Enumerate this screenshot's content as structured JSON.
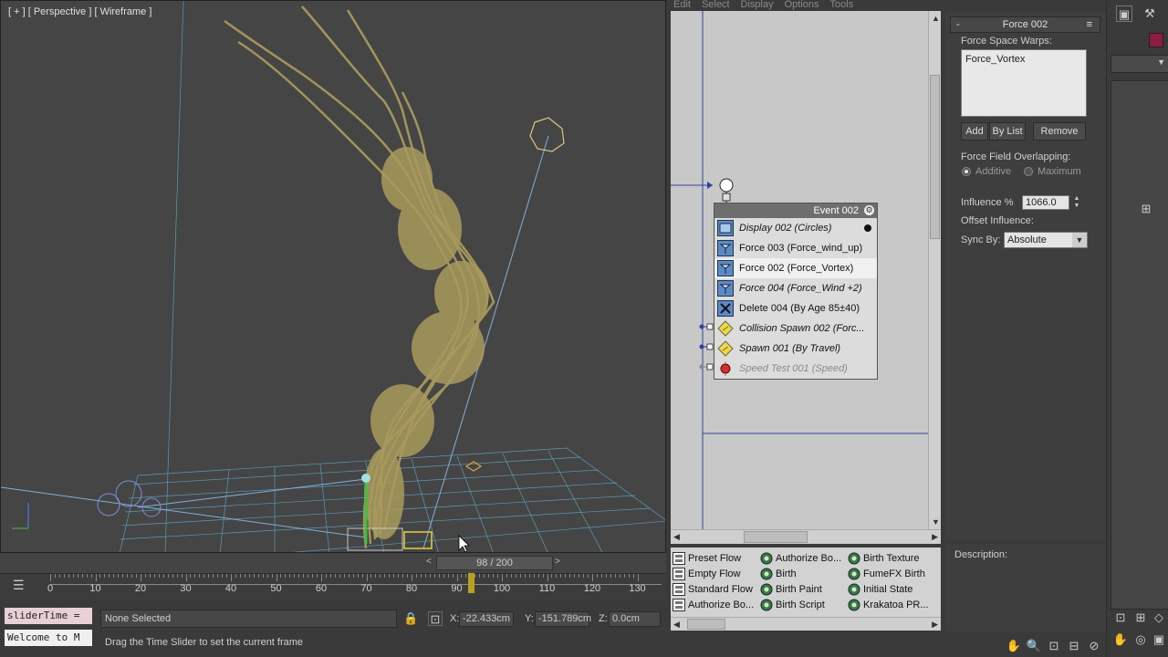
{
  "viewport": {
    "label": "[ + ] [ Perspective ] [ Wireframe ]"
  },
  "timeslider": {
    "position": "98 / 200",
    "prev": "<",
    "next": ">"
  },
  "trackbar": {
    "ticks": [
      "0",
      "10",
      "20",
      "30",
      "40",
      "50",
      "60",
      "70",
      "80",
      "90",
      "100",
      "110",
      "120",
      "130"
    ]
  },
  "status": {
    "maxscript_a": "sliderTime =",
    "maxscript_b": "Welcome to M",
    "selection": "None Selected",
    "prompt": "Drag the Time Slider to set the current frame",
    "x_label": "X:",
    "x_value": "-22.433cm",
    "y_label": "Y:",
    "y_value": "-151.789cm",
    "z_label": "Z:",
    "z_value": "0.0cm"
  },
  "particle_view": {
    "menu": [
      "Edit",
      "Select",
      "Display",
      "Options",
      "Tools"
    ],
    "event": {
      "title": "Event 002",
      "operators": [
        {
          "label": "Display 002 (Circles)",
          "icon": "display-icon",
          "style": "italic"
        },
        {
          "label": "Force 003 (Force_wind_up)",
          "icon": "force-icon",
          "style": "normal"
        },
        {
          "label": "Force 002 (Force_Vortex)",
          "icon": "force-icon",
          "style": "selected"
        },
        {
          "label": "Force 004 (Force_Wind +2)",
          "icon": "force-icon",
          "style": "italic"
        },
        {
          "label": "Delete 004 (By Age 85±40)",
          "icon": "delete-icon",
          "style": "normal"
        },
        {
          "label": "Collision Spawn 002 (Forc...",
          "icon": "test-icon",
          "style": "italic"
        },
        {
          "label": "Spawn 001 (By Travel)",
          "icon": "test-icon",
          "style": "italic"
        },
        {
          "label": "Speed Test 001 (Speed)",
          "icon": "speed-test-icon",
          "style": "disabled"
        }
      ]
    },
    "depot": [
      {
        "label": "Preset Flow",
        "icon": "flow-icon"
      },
      {
        "label": "Empty Flow",
        "icon": "flow-icon"
      },
      {
        "label": "Standard Flow",
        "icon": "flow-icon"
      },
      {
        "label": "Authorize Bo...",
        "icon": "flow-icon"
      },
      {
        "label": "Authorize Bo...",
        "icon": "birth-icon"
      },
      {
        "label": "Birth",
        "icon": "birth-icon"
      },
      {
        "label": "Birth Paint",
        "icon": "birth-icon"
      },
      {
        "label": "Birth Script",
        "icon": "birth-icon"
      },
      {
        "label": "Birth Texture",
        "icon": "birth-icon"
      },
      {
        "label": "FumeFX Birth",
        "icon": "birth-icon"
      },
      {
        "label": "Initial State",
        "icon": "birth-icon"
      },
      {
        "label": "Krakatoa PR...",
        "icon": "birth-icon"
      }
    ],
    "description_label": "Description:"
  },
  "parameters": {
    "rollout_title": "Force 002",
    "rollout_minus": "-",
    "rollout_eq": "≡",
    "fsw_label": "Force Space Warps:",
    "fsw_items": [
      "Force_Vortex"
    ],
    "btn_add": "Add",
    "btn_bylist": "By List",
    "btn_remove": "Remove",
    "overlap_label": "Force Field Overlapping:",
    "radio_additive": "Additive",
    "radio_maximum": "Maximum",
    "influence_label": "Influence %",
    "influence_value": "1066.0",
    "offset_label": "Offset Influence:",
    "sync_label": "Sync By:",
    "sync_value": "Absolute"
  },
  "colors": {
    "particles": "#a89a5c",
    "grid": "#5fb8d8",
    "event_header": "#6e6e6e",
    "cmd_color_swatch": "#8c1c44"
  }
}
